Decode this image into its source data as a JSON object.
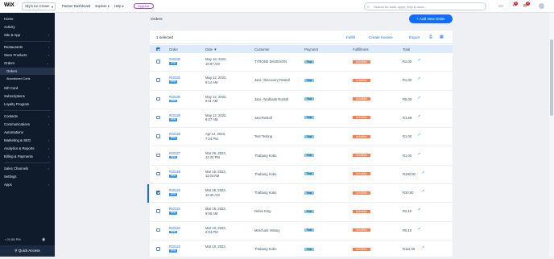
{
  "topbar": {
    "logo": "WiX",
    "site_name": "Sky's Ice Cream",
    "nav": [
      "Partner Dashboard",
      "Explore",
      "Help"
    ],
    "upgrade": "Upgrade",
    "search_placeholder": "Search for tools, apps, help & more...",
    "notif_count": "5",
    "inbox_count": "2"
  },
  "sidebar": {
    "items": [
      "Home",
      "Activity",
      "Site & App",
      "Restaurants",
      "Store Products",
      "Orders",
      "Orders",
      "Abandoned Carts",
      "Gift Card",
      "Subscriptions",
      "Loyalty Program",
      "Contacts",
      "Communications",
      "Automations",
      "Marketing & SEO",
      "Analytics & Reports",
      "Billing & Payments",
      "Sales Channels",
      "Settings",
      "Apps"
    ],
    "time": "• 01:55 PM",
    "quick_access": "Quick Access"
  },
  "page": {
    "title": "Orders",
    "add_button": "+ Add New Order"
  },
  "toolbar": {
    "selected": "1 selected",
    "fulfill": "Fulfill",
    "invoice": "Create Invoice",
    "export": "Export"
  },
  "columns": {
    "order": "Order",
    "date": "Date ▼",
    "customer": "Customer",
    "payment": "Payment",
    "fulfillment": "Fulfillment",
    "total": "Total"
  },
  "rows": [
    {
      "order": "#10132",
      "badge": "New",
      "date": "May 19, 2023,",
      "time": "10:07 AM",
      "customer": "TYRONE DAVIDSON",
      "payment": "Paid",
      "fulfillment": "Unfulfilled",
      "total": "R2,00"
    },
    {
      "order": "#10131",
      "badge": "New",
      "date": "May 12, 2023,",
      "time": "9:14 AM",
      "customer": "Jani - Discovery Rostoll",
      "payment": "Paid",
      "fulfillment": "Unfulfilled",
      "total": "R1,00"
    },
    {
      "order": "#10130",
      "badge": "New",
      "date": "May 12, 2023,",
      "time": "9:11 AM",
      "customer": "Jani - Nedbank Rostoll",
      "payment": "Paid",
      "fulfillment": "Unfulfilled",
      "total": "R5,00"
    },
    {
      "order": "#10129",
      "badge": "New",
      "date": "May 12, 2023,",
      "time": "9:07 AM",
      "customer": "Jani Rostoll",
      "payment": "Paid",
      "fulfillment": "Unfulfilled",
      "total": "R1,89"
    },
    {
      "order": "#10128",
      "badge": "New",
      "date": "Apr 12, 2023,",
      "time": "7:24 PM",
      "customer": "Test Testing",
      "payment": "Paid",
      "fulfillment": "Unfulfilled",
      "total": "R1,00"
    },
    {
      "order": "#10127",
      "badge": "New",
      "date": "Mar 29, 2023,",
      "time": "12:32 PM",
      "customer": "Thabang Kobo",
      "payment": "Paid",
      "fulfillment": "Unfulfilled",
      "total": "R1,00"
    },
    {
      "order": "#10126",
      "badge": "New",
      "date": "Mar 16, 2023,",
      "time": "11:04 AM",
      "customer": "Thabang Kobo",
      "payment": "Paid",
      "fulfillment": "Unfulfilled",
      "total": "R100,00"
    },
    {
      "order": "#10125",
      "badge": "New",
      "date": "Mar 16, 2023,",
      "time": "10:49 AM",
      "customer": "Thabang Kobo",
      "payment": "Paid",
      "fulfillment": "Unfulfilled",
      "total": "R30,00"
    },
    {
      "order": "#10124",
      "badge": "New",
      "date": "Mar 16, 2023,",
      "time": "9:08 AM",
      "customer": "Debni King",
      "payment": "Paid",
      "fulfillment": "Unfulfilled",
      "total": "R2,10"
    },
    {
      "order": "#10123",
      "badge": "New",
      "date": "Mar 10, 2023,",
      "time": "2:04 PM",
      "customer": "Merchant History",
      "payment": "Paid",
      "fulfillment": "Unfulfilled",
      "total": "R0,10"
    },
    {
      "order": "#10122",
      "badge": "New",
      "date": "Mar 10, 2023,",
      "time": "",
      "customer": "Thabang Kobo",
      "payment": "Paid",
      "fulfillment": "Unfulfilled",
      "total": "R111,00"
    }
  ],
  "selected_row": 7
}
